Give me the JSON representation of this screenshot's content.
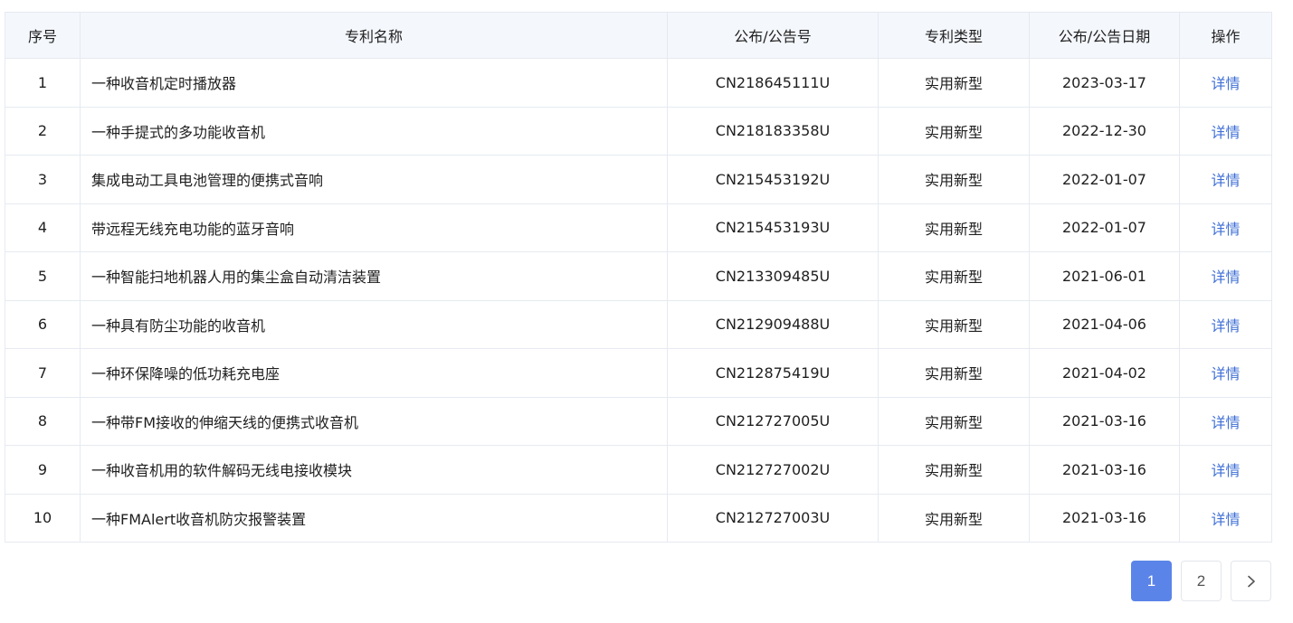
{
  "table": {
    "headers": [
      "序号",
      "专利名称",
      "公布/公告号",
      "专利类型",
      "公布/公告日期",
      "操作"
    ],
    "rows": [
      {
        "no": "1",
        "name": "一种收音机定时播放器",
        "pub_no": "CN218645111U",
        "type": "实用新型",
        "date": "2023-03-17",
        "action": "详情"
      },
      {
        "no": "2",
        "name": "一种手提式的多功能收音机",
        "pub_no": "CN218183358U",
        "type": "实用新型",
        "date": "2022-12-30",
        "action": "详情"
      },
      {
        "no": "3",
        "name": "集成电动工具电池管理的便携式音响",
        "pub_no": "CN215453192U",
        "type": "实用新型",
        "date": "2022-01-07",
        "action": "详情"
      },
      {
        "no": "4",
        "name": "带远程无线充电功能的蓝牙音响",
        "pub_no": "CN215453193U",
        "type": "实用新型",
        "date": "2022-01-07",
        "action": "详情"
      },
      {
        "no": "5",
        "name": "一种智能扫地机器人用的集尘盒自动清洁装置",
        "pub_no": "CN213309485U",
        "type": "实用新型",
        "date": "2021-06-01",
        "action": "详情"
      },
      {
        "no": "6",
        "name": "一种具有防尘功能的收音机",
        "pub_no": "CN212909488U",
        "type": "实用新型",
        "date": "2021-04-06",
        "action": "详情"
      },
      {
        "no": "7",
        "name": "一种环保降噪的低功耗充电座",
        "pub_no": "CN212875419U",
        "type": "实用新型",
        "date": "2021-04-02",
        "action": "详情"
      },
      {
        "no": "8",
        "name": "一种带FM接收的伸缩天线的便携式收音机",
        "pub_no": "CN212727005U",
        "type": "实用新型",
        "date": "2021-03-16",
        "action": "详情"
      },
      {
        "no": "9",
        "name": "一种收音机用的软件解码无线电接收模块",
        "pub_no": "CN212727002U",
        "type": "实用新型",
        "date": "2021-03-16",
        "action": "详情"
      },
      {
        "no": "10",
        "name": "一种FMAlert收音机防灾报警装置",
        "pub_no": "CN212727003U",
        "type": "实用新型",
        "date": "2021-03-16",
        "action": "详情"
      }
    ]
  },
  "pagination": {
    "pages": [
      "1",
      "2"
    ],
    "current": "1",
    "next_icon": "chevron-right-icon"
  },
  "colors": {
    "link": "#3f6fd6",
    "active_page": "#5b84e8",
    "header_bg": "#f4f7fc",
    "border": "#e6eaf0"
  }
}
